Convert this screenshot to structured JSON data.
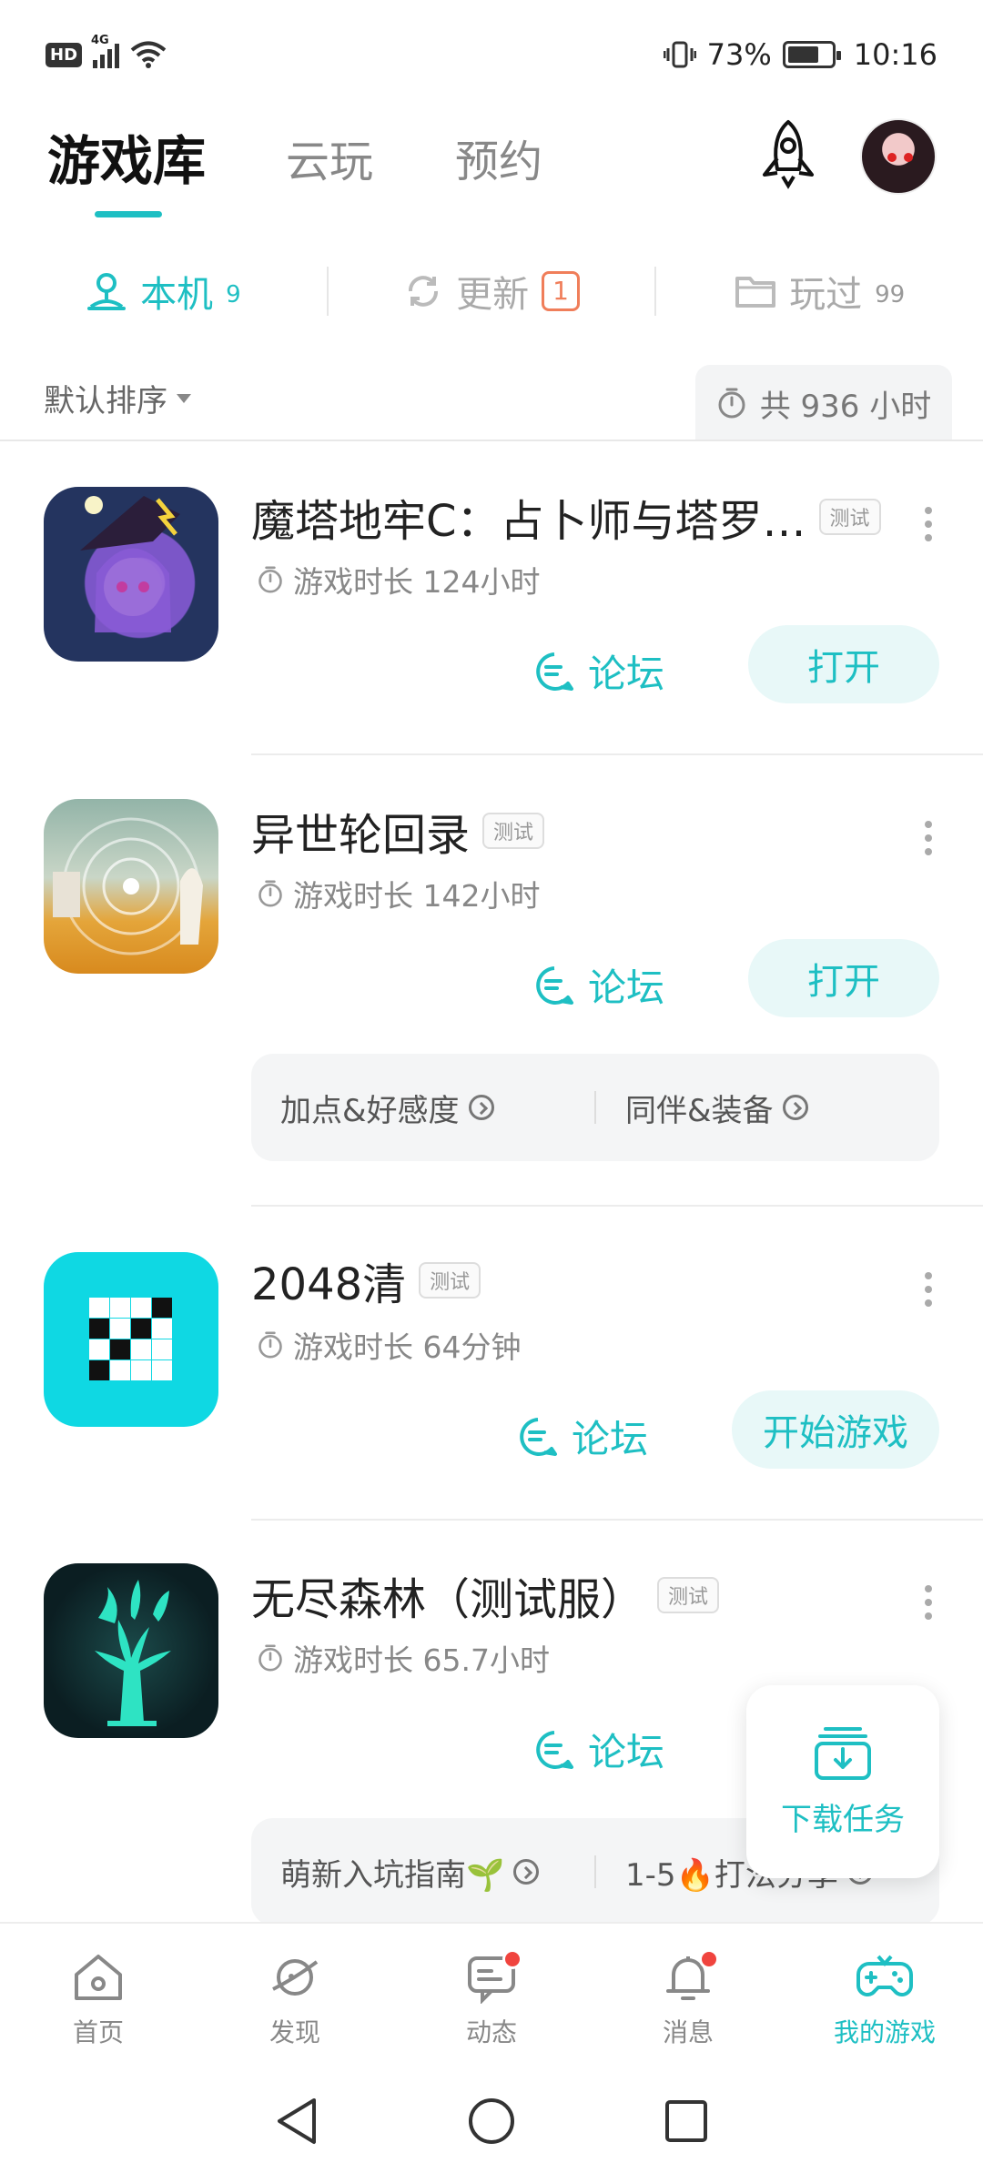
{
  "status_bar": {
    "hd": "HD",
    "network": "4G",
    "battery_percent": "73%",
    "battery_level": 0.73,
    "time": "10:16"
  },
  "header": {
    "tabs": [
      {
        "label": "游戏库",
        "active": true
      },
      {
        "label": "云玩",
        "active": false
      },
      {
        "label": "预约",
        "active": false
      }
    ],
    "rocket_icon": "rocket-icon",
    "avatar_icon": "user-avatar"
  },
  "sub_tabs": [
    {
      "label": "本机",
      "count": "9",
      "icon": "local-device-icon",
      "active": true
    },
    {
      "label": "更新",
      "count": "1",
      "icon": "refresh-icon",
      "active": false
    },
    {
      "label": "玩过",
      "count": "99",
      "icon": "folder-icon",
      "active": false
    }
  ],
  "sort": {
    "label": "默认排序",
    "total_time": "共 936 小时"
  },
  "games": [
    {
      "title": "魔塔地牢C：占卜师与塔罗…",
      "tag": "测试",
      "playtime": "游戏时长 124小时",
      "forum_label": "论坛",
      "action_label": "打开"
    },
    {
      "title": "异世轮回录",
      "tag": "测试",
      "playtime": "游戏时长 142小时",
      "forum_label": "论坛",
      "action_label": "打开",
      "guides": [
        "加点&好感度",
        "同伴&装备"
      ]
    },
    {
      "title": "2048清",
      "tag": "测试",
      "playtime": "游戏时长 64分钟",
      "forum_label": "论坛",
      "action_label": "开始游戏"
    },
    {
      "title": "无尽森林（测试服）",
      "tag": "测试",
      "playtime": "游戏时长 65.7小时",
      "forum_label": "论坛",
      "guides": [
        "萌新入坑指南🌱",
        "1-5🔥打法分享"
      ]
    }
  ],
  "download_task": {
    "label": "下载任务"
  },
  "bottom_nav": [
    {
      "label": "首页",
      "icon": "home-icon",
      "active": false,
      "dot": false
    },
    {
      "label": "发现",
      "icon": "discover-planet-icon",
      "active": false,
      "dot": false
    },
    {
      "label": "动态",
      "icon": "feed-chat-icon",
      "active": false,
      "dot": true
    },
    {
      "label": "消息",
      "icon": "bell-icon",
      "active": false,
      "dot": true
    },
    {
      "label": "我的游戏",
      "icon": "gamepad-icon",
      "active": true,
      "dot": false
    }
  ],
  "colors": {
    "accent": "#1ebfc3",
    "badge_orange": "#f07e5a",
    "red_dot": "#f0443e"
  }
}
